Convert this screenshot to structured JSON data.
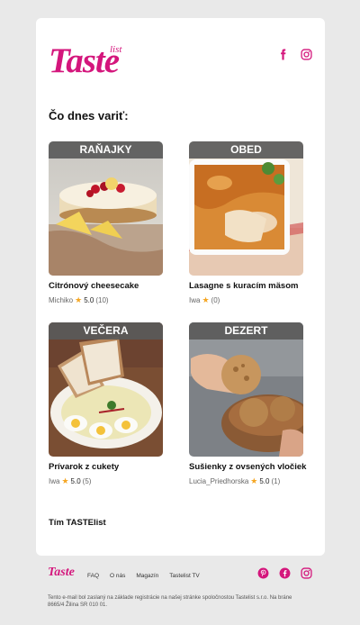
{
  "brand": {
    "logo_text": "Taste",
    "logo_sub": "list",
    "accent": "#d4167c"
  },
  "header": {
    "icons": [
      "facebook-icon",
      "instagram-icon"
    ]
  },
  "heading": "Čo dnes variť:",
  "recipes": [
    {
      "category": "RAŇAJKY",
      "name": "Citrónový cheesecake",
      "author": "Michiko",
      "rating": "5.0",
      "count": "(10)",
      "image": "cheesecake"
    },
    {
      "category": "OBED",
      "name": "Lasagne s kuracím mäsom",
      "author": "Iwa",
      "rating": "",
      "count": "(0)",
      "image": "lasagne"
    },
    {
      "category": "VEČERA",
      "name": "Prívarok z cukety",
      "author": "Iwa",
      "rating": "5.0",
      "count": "(5)",
      "image": "zucchini-stew"
    },
    {
      "category": "DEZERT",
      "name": "Sušienky z ovsených vločiek",
      "author": "Lucia_Priedhorska",
      "rating": "5.0",
      "count": "(1)",
      "image": "oat-cookies"
    }
  ],
  "signature": "Tím TASTElist",
  "footer": {
    "logo": "Taste",
    "nav": [
      "FAQ",
      "O nás",
      "Magazín",
      "Tastelist TV"
    ],
    "icons": [
      "pinterest-icon",
      "facebook-icon",
      "instagram-icon"
    ],
    "legal": "Tento e-mail bol zaslaný na základe registrácie na našej stránke spoločnostou Tastelist s.r.o. Na bráne 8665/4 Žilina SR 010 01."
  },
  "colors": {
    "page_bg": "#e9e9e9",
    "card_bg": "#ffffff",
    "category_bar": "#5a5a5a",
    "star": "#f5a623"
  }
}
